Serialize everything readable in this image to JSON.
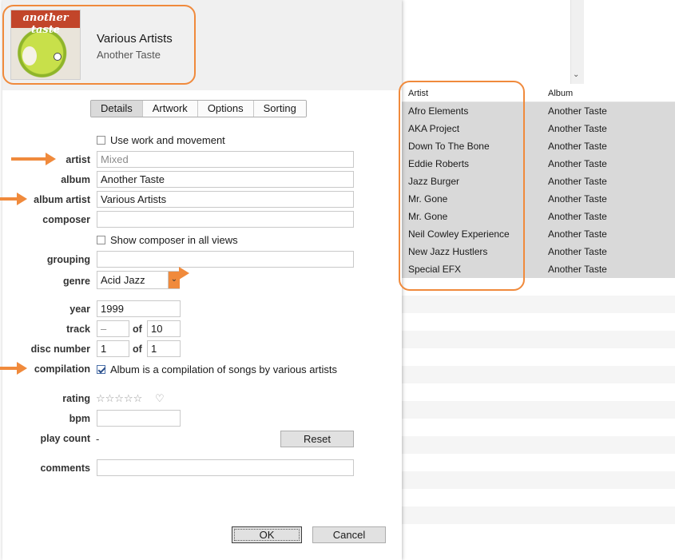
{
  "header": {
    "title": "Various Artists",
    "subtitle": "Another Taste",
    "artwork_text": "another taste"
  },
  "tabs": [
    {
      "label": "Details",
      "active": true
    },
    {
      "label": "Artwork",
      "active": false
    },
    {
      "label": "Options",
      "active": false
    },
    {
      "label": "Sorting",
      "active": false
    }
  ],
  "details": {
    "use_work_movement": {
      "label": "Use work and movement",
      "checked": false
    },
    "artist": {
      "label": "artist",
      "value": "",
      "placeholder": "Mixed"
    },
    "album": {
      "label": "album",
      "value": "Another Taste"
    },
    "album_artist": {
      "label": "album artist",
      "value": "Various Artists"
    },
    "composer": {
      "label": "composer",
      "value": ""
    },
    "show_composer": {
      "label": "Show composer in all views",
      "checked": false
    },
    "grouping": {
      "label": "grouping",
      "value": ""
    },
    "genre": {
      "label": "genre",
      "value": "Acid Jazz"
    },
    "year": {
      "label": "year",
      "value": "1999"
    },
    "track": {
      "label": "track",
      "value": "–",
      "of_label": "of",
      "of_value": "10"
    },
    "disc_number": {
      "label": "disc number",
      "value": "1",
      "of_label": "of",
      "of_value": "1"
    },
    "compilation": {
      "label": "compilation",
      "text": "Album is a compilation of songs by various artists",
      "checked": true
    },
    "rating": {
      "label": "rating",
      "stars": "☆☆☆☆☆",
      "heart": "♡",
      "value": 0
    },
    "bpm": {
      "label": "bpm",
      "value": ""
    },
    "play_count": {
      "label": "play count",
      "value": "-"
    },
    "reset_label": "Reset",
    "comments": {
      "label": "comments",
      "value": ""
    }
  },
  "footer": {
    "ok_label": "OK",
    "cancel_label": "Cancel"
  },
  "list": {
    "columns": [
      "Artist",
      "Album"
    ],
    "rows": [
      [
        "Afro Elements",
        "Another Taste"
      ],
      [
        "AKA Project",
        "Another Taste"
      ],
      [
        "Down To The Bone",
        "Another Taste"
      ],
      [
        "Eddie Roberts",
        "Another Taste"
      ],
      [
        "Jazz Burger",
        "Another Taste"
      ],
      [
        "Mr. Gone",
        "Another Taste"
      ],
      [
        "Mr. Gone",
        "Another Taste"
      ],
      [
        "Neil Cowley Experience",
        "Another Taste"
      ],
      [
        "New Jazz Hustlers",
        "Another Taste"
      ],
      [
        "Special EFX",
        "Another Taste"
      ]
    ]
  },
  "colors": {
    "annotation": "#f08a3c",
    "selection": "#d9d9d9",
    "header_bg": "#f0f0f0"
  },
  "icons": [
    "chevron-down-icon",
    "checkbox-icon",
    "star-icon",
    "heart-icon",
    "arrow-annotation-icon"
  ]
}
